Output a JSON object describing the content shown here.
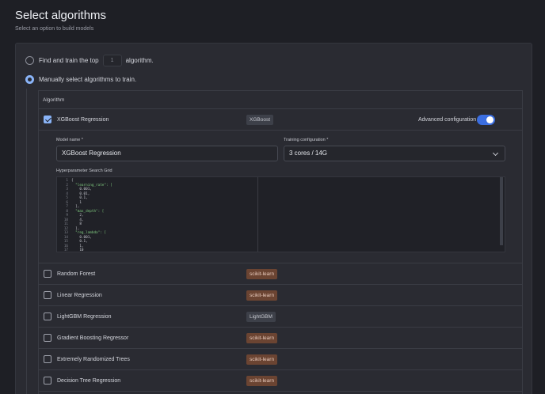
{
  "page": {
    "title": "Select algorithms",
    "subtitle": "Select an option to build models"
  },
  "options": {
    "top_prefix": "Find and train the top",
    "top_value": "1",
    "top_suffix": "algorithm.",
    "manual_label": "Manually select algorithms to train."
  },
  "table": {
    "header": "Algorithm",
    "rows": [
      {
        "name": "XGBoost Regression",
        "badge": "XGBoost",
        "checked": true
      },
      {
        "name": "Random Forest",
        "badge": "scikit-learn",
        "checked": false
      },
      {
        "name": "Linear Regression",
        "badge": "scikit-learn",
        "checked": false
      },
      {
        "name": "LightGBM Regression",
        "badge": "LightGBM",
        "checked": false
      },
      {
        "name": "Gradient Boosting Regressor",
        "badge": "scikit-learn",
        "checked": false
      },
      {
        "name": "Extremely Randomized Trees",
        "badge": "scikit-learn",
        "checked": false
      },
      {
        "name": "Decision Tree Regression",
        "badge": "scikit-learn",
        "checked": false
      }
    ]
  },
  "xgboost": {
    "advanced_label": "Advanced configuration",
    "model_name_label": "Model name *",
    "model_name_value": "XGBoost Regression",
    "training_config_label": "Training configuration *",
    "training_config_value": "3 cores / 14G",
    "grid_label": "Hyperparameter Search Grid",
    "code": [
      {
        "n": "1",
        "t": "{"
      },
      {
        "n": "2",
        "t": "  \"learning_rate\": ["
      },
      {
        "n": "3",
        "t": "    0.001,"
      },
      {
        "n": "4",
        "t": "    0.01,"
      },
      {
        "n": "5",
        "t": "    0.1,"
      },
      {
        "n": "6",
        "t": "    1"
      },
      {
        "n": "7",
        "t": "  ],"
      },
      {
        "n": "8",
        "t": "  \"max_depth\": ["
      },
      {
        "n": "9",
        "t": "    2,"
      },
      {
        "n": "10",
        "t": "    4,"
      },
      {
        "n": "11",
        "t": "    8"
      },
      {
        "n": "12",
        "t": "  ],"
      },
      {
        "n": "13",
        "t": "  \"reg_lambda\": ["
      },
      {
        "n": "14",
        "t": "    0.001,"
      },
      {
        "n": "15",
        "t": "    0.1,"
      },
      {
        "n": "16",
        "t": "    1,"
      },
      {
        "n": "17",
        "t": "    10"
      }
    ]
  },
  "colors": {
    "accent": "#8ab4f8",
    "toggle_on": "#3b6ee0",
    "badge_sklearn": "#6b4432"
  }
}
